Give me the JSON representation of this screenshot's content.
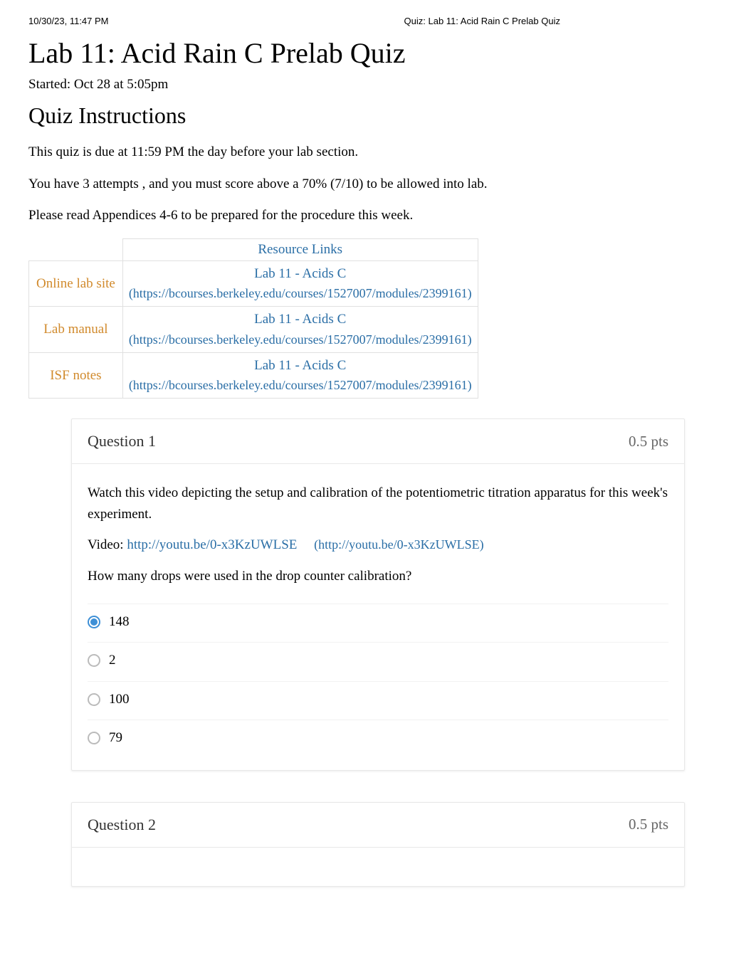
{
  "header": {
    "timestamp": "10/30/23, 11:47 PM",
    "doc_title": "Quiz: Lab 11: Acid Rain C Prelab Quiz"
  },
  "title": "Lab 11: Acid Rain C Prelab Quiz",
  "started": "Started: Oct 28 at 5:05pm",
  "instructions_heading": "Quiz Instructions",
  "instr": {
    "line1_a": "This quiz is due at ",
    "line1_b": "11:59 PM the day before",
    "line1_c": " your lab section.",
    "line2_a": "You have ",
    "line2_b": "3 attempts",
    "line2_c": ", and you must score above a ",
    "line2_d": "70%",
    "line2_e": " (7/10) to be allowed into lab.",
    "line3": "Please read Appendices 4-6 to be prepared for the procedure this week."
  },
  "resources": {
    "caption": "Resource Links",
    "rows": [
      {
        "label": "Online lab site",
        "title": "Lab 11 - Acids C",
        "url": "(https://bcourses.berkeley.edu/courses/1527007/modules/2399161)"
      },
      {
        "label": "Lab manual",
        "title": "Lab 11 - Acids C",
        "url": "(https://bcourses.berkeley.edu/courses/1527007/modules/2399161)"
      },
      {
        "label": "ISF notes",
        "title": "Lab 11 - Acids C",
        "url": "(https://bcourses.berkeley.edu/courses/1527007/modules/2399161)"
      }
    ]
  },
  "questions": [
    {
      "label": "Question 1",
      "pts": "0.5 pts",
      "body1": "Watch this video depicting the setup and calibration of the potentiometric titration apparatus for this week's experiment.",
      "video_prefix": "Video: ",
      "video_link": "http://youtu.be/0-x3KzUWLSE",
      "video_paren": "(http://youtu.be/0-x3KzUWLSE)",
      "body2": "How many drops were used in the drop counter calibration?",
      "answers": [
        {
          "text": "148",
          "selected": true
        },
        {
          "text": "2",
          "selected": false
        },
        {
          "text": "100",
          "selected": false
        },
        {
          "text": "79",
          "selected": false
        }
      ]
    },
    {
      "label": "Question 2",
      "pts": "0.5 pts"
    }
  ]
}
